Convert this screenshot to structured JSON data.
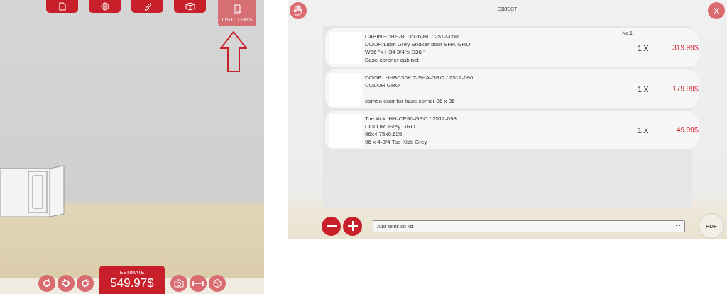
{
  "room_view": {
    "toolbar": [
      {
        "kind": "document",
        "selected": false
      },
      {
        "kind": "globe",
        "selected": false
      },
      {
        "kind": "brush",
        "selected": false
      },
      {
        "kind": "box",
        "selected": false
      },
      {
        "kind": "list",
        "label": "LIST ITEMS",
        "selected": true
      }
    ],
    "bottom_tools_left": [
      {
        "kind": "rotate"
      },
      {
        "kind": "undo"
      },
      {
        "kind": "redo"
      }
    ],
    "estimate": {
      "label": "ESTIMATE",
      "total": "549.97$"
    },
    "bottom_tools_right": [
      {
        "kind": "camera"
      },
      {
        "kind": "measure"
      },
      {
        "kind": "cube"
      }
    ]
  },
  "object_panel": {
    "title": "OBJECT",
    "close": "X",
    "number": "No.1",
    "items": [
      {
        "lines": [
          "CABINET:HH-BC3636-BL / 2512-050",
          "DOOR:Light Grey Shaker door SHA-GRO",
          "W36 ''x H34 3/4''x D36 ''",
          "Base corener cabinet"
        ],
        "gap_before_last": false,
        "quantity": "1",
        "times": "X",
        "price": "319.99$"
      },
      {
        "lines": [
          "DOOR: HHBC36KIT-SHA-GRO / 2512-096",
          "COLOR:GRO",
          "combo door for base corner 36 x 36"
        ],
        "gap_before_last": true,
        "quantity": "1",
        "times": "X",
        "price": "179.99$"
      },
      {
        "lines": [
          "Toe kick: HH-CP96-GRO / 2512-098",
          "COLOR: Grey GRO",
          "96x4.75x0.625",
          "96 x 4-3/4  Toe Kick Grey"
        ],
        "gap_before_last": false,
        "quantity": "1",
        "times": "X",
        "price": "49.99$"
      }
    ],
    "add_select": {
      "placeholder": "Add items on list"
    },
    "pdf": "PDF"
  }
}
